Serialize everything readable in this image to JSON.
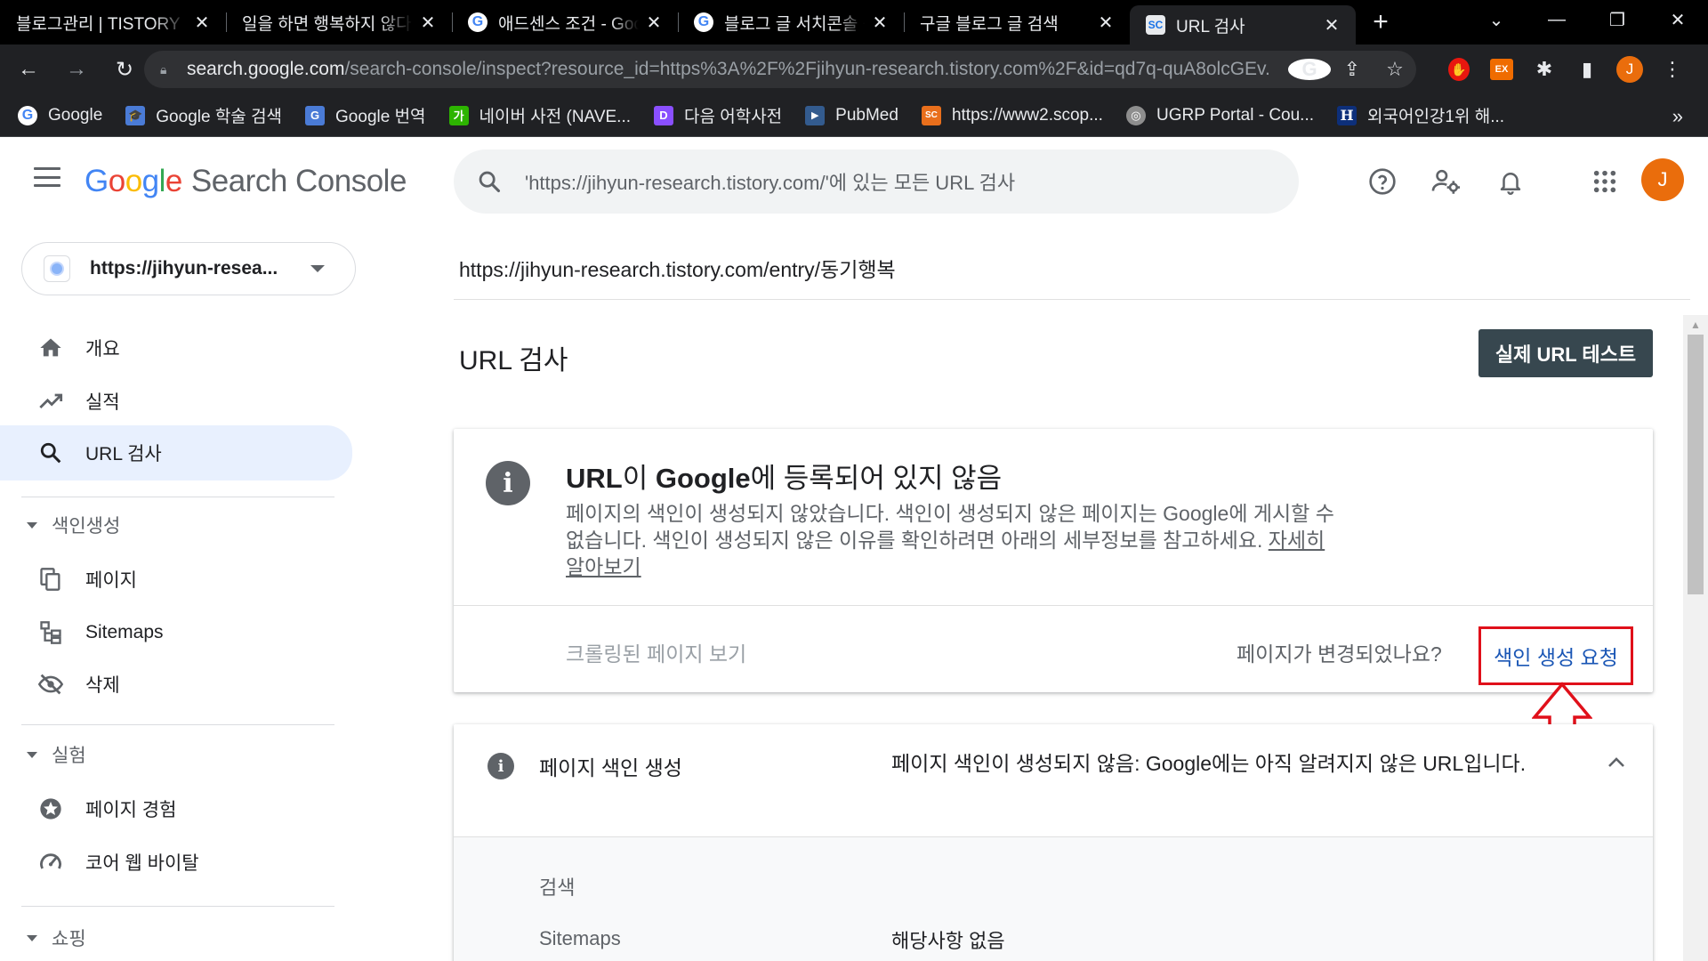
{
  "browser": {
    "tabs": [
      {
        "favicon": "",
        "title": "블로그관리 | TISTORY",
        "active": false
      },
      {
        "favicon": "",
        "title": "일을 하면 행복하지 않다",
        "active": false
      },
      {
        "favicon": "G",
        "title": "애드센스 조건 - Google",
        "active": false
      },
      {
        "favicon": "G",
        "title": "블로그 글 서치콘솔 등록",
        "active": false
      },
      {
        "favicon": "",
        "title": "구글 블로그 글 검색",
        "active": false
      },
      {
        "favicon": "SC",
        "title": "URL 검사",
        "active": true
      }
    ],
    "url_host": "search.google.com",
    "url_rest": "/search-console/inspect?resource_id=https%3A%2F%2Fjihyun-research.tistory.com%2F&id=qd7q-quA8olcGEv...",
    "profile_initial": "J",
    "ext_label": "EX"
  },
  "bookmarks": [
    {
      "icon": "G",
      "color": "#ffffff",
      "text_color": "#4285f4",
      "label": "Google"
    },
    {
      "icon": "🎓",
      "color": "#4a7bd6",
      "text_color": "#ffffff",
      "label": "Google 학술 검색"
    },
    {
      "icon": "G",
      "color": "#4a7bd6",
      "text_color": "#ffffff",
      "label": "Google 번역"
    },
    {
      "icon": "가",
      "color": "#2db400",
      "text_color": "#ffffff",
      "label": "네이버 사전 (NAVE..."
    },
    {
      "icon": "D",
      "color": "#8a4fff",
      "text_color": "#ffffff",
      "label": "다음 어학사전"
    },
    {
      "icon": "▶",
      "color": "#335b8e",
      "text_color": "#ffffff",
      "label": "PubMed"
    },
    {
      "icon": "SC",
      "color": "#e96f1c",
      "text_color": "#ffffff",
      "label": "https://www2.scop..."
    },
    {
      "icon": "◎",
      "color": "#8e8e8e",
      "text_color": "#ffffff",
      "label": "UGRP Portal - Cou..."
    },
    {
      "icon": "H",
      "color": "#0d2f7a",
      "text_color": "#ffffff",
      "label": "외국어인강1위 해..."
    }
  ],
  "header": {
    "brand_letters": [
      "G",
      "o",
      "o",
      "g",
      "l",
      "e"
    ],
    "product": "Search Console",
    "search_placeholder": "'https://jihyun-research.tistory.com/'에 있는 모든 URL 검사",
    "avatar_initial": "J"
  },
  "sidebar": {
    "property": "https://jihyun-resea...",
    "items": [
      {
        "icon": "home-icon",
        "label": "개요"
      },
      {
        "icon": "trending-up-icon",
        "label": "실적"
      },
      {
        "icon": "search-icon",
        "label": "URL 검사"
      },
      {
        "icon": "pages-icon",
        "label": "페이지"
      },
      {
        "icon": "sitemap-icon",
        "label": "Sitemaps"
      },
      {
        "icon": "removals-icon",
        "label": "삭제"
      },
      {
        "icon": "page-experience-icon",
        "label": "페이지 경험"
      },
      {
        "icon": "core-web-vitals-icon",
        "label": "코어 웹 바이탈"
      }
    ],
    "sections": [
      "색인생성",
      "실험",
      "쇼핑"
    ]
  },
  "main": {
    "inspected_url": "https://jihyun-research.tistory.com/entry/동기행복",
    "title": "URL 검사",
    "live_test_button": "실제 URL 테스트",
    "status": {
      "title_part1": "URL",
      "title_part2": "이 ",
      "title_part3": "Google",
      "title_part4": "에 등록되어 있지 않음",
      "description": "페이지의 색인이 생성되지 않았습니다. 색인이 생성되지 않은 페이지는 Google에 게시할 수 없습니다. 색인이 생성되지 않은 이유를 확인하려면 아래의 세부정보를 참고하세요. ",
      "learn_more": "자세히 알아보기",
      "view_crawled": "크롤링된 페이지 보기",
      "changed_question": "페이지가 변경되었나요?",
      "request_indexing": "색인 생성 요청"
    },
    "indexing": {
      "label": "페이지 색인 생성",
      "value": "페이지 색인이 생성되지 않음: Google에는 아직 알려지지 않은 URL입니다.",
      "rows": [
        {
          "label": "검색",
          "value": ""
        },
        {
          "label": "Sitemaps",
          "value": "해당사항 없음"
        }
      ]
    }
  },
  "colors": {
    "accent_red_box": "#e0101a",
    "button_dark": "#37474f",
    "nav_active_bg": "#e8f0fe"
  }
}
